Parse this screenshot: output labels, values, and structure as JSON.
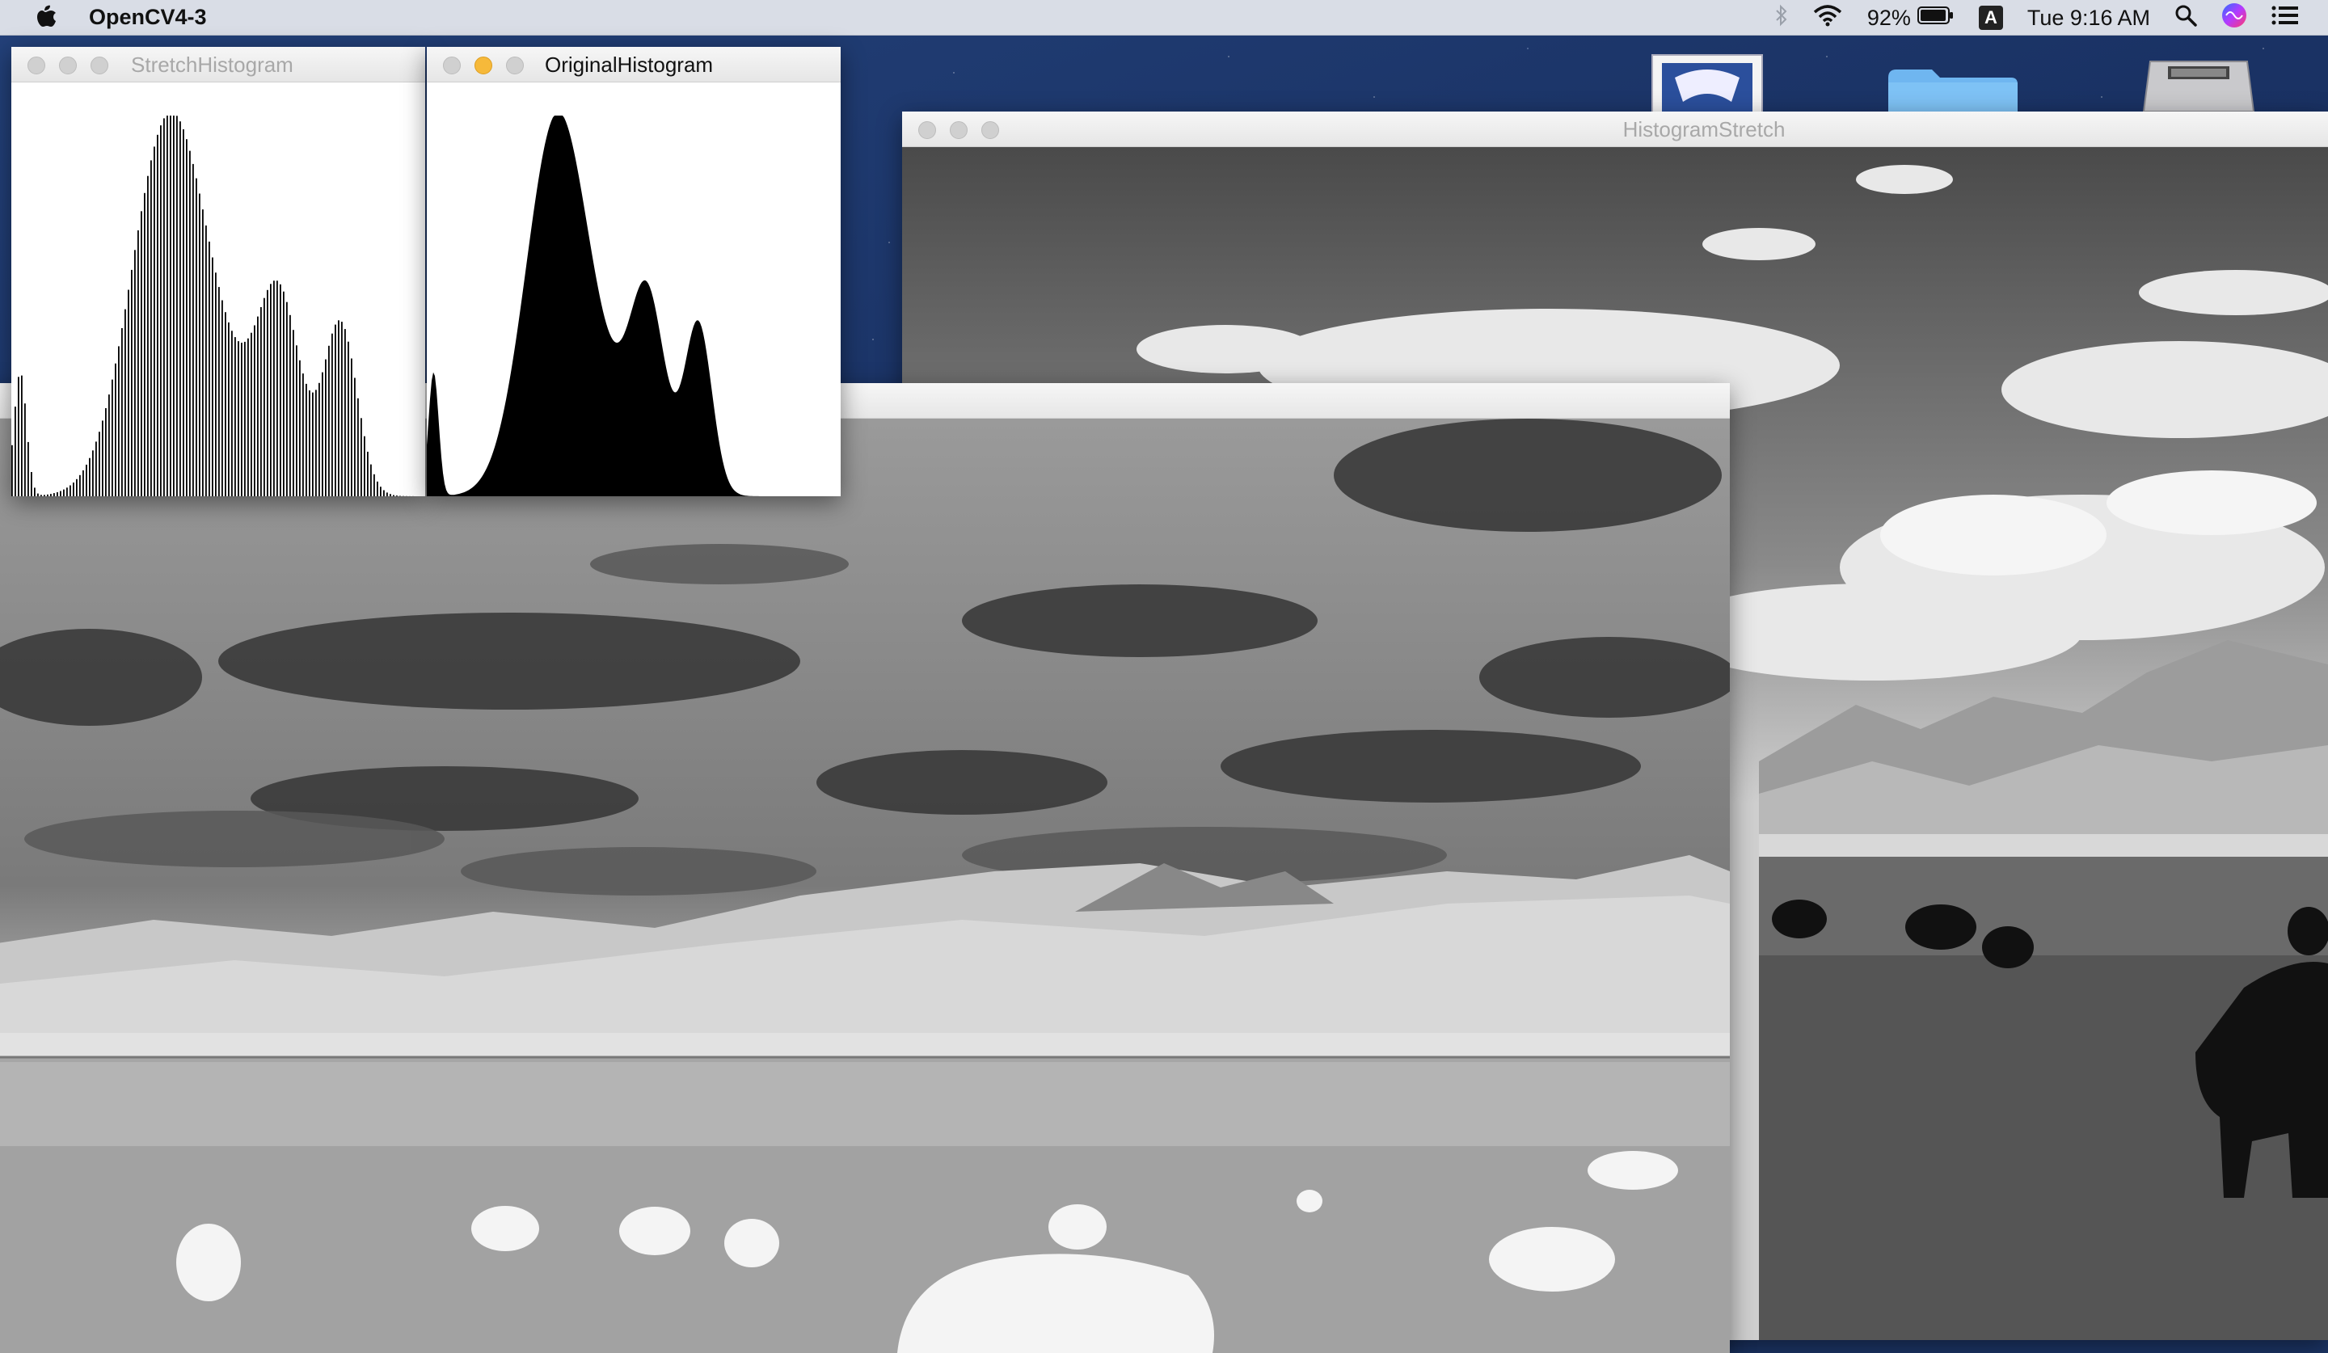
{
  "menubar": {
    "app_name": "OpenCV4-3",
    "battery_percent": "92%",
    "input_source": "A",
    "clock": "Tue 9:16 AM",
    "icons": [
      "apple-icon",
      "bluetooth-icon",
      "wifi-icon",
      "battery-icon",
      "input-source-icon",
      "spotlight-search-icon",
      "siri-icon",
      "notification-center-icon"
    ]
  },
  "windows": {
    "stretch_histogram": {
      "title": "StretchHistogram"
    },
    "original_histogram": {
      "title": "OriginalHistogram"
    },
    "histogram_stretch": {
      "title": "HistogramStretch"
    },
    "inverted_image": {
      "title": ""
    }
  },
  "desktop_icons": [
    "app-document-icon",
    "folder-icon",
    "hard-drive-icon"
  ],
  "colors": {
    "menubar": "#d9dde6",
    "close_light": "#d0d0d0",
    "minimize_light_active": "#f6b93a",
    "histogram_fill": "#000000",
    "desktop": "#1c3566"
  },
  "scene": "grayscale landscape with yaks, mountains, and cloudy sky"
}
